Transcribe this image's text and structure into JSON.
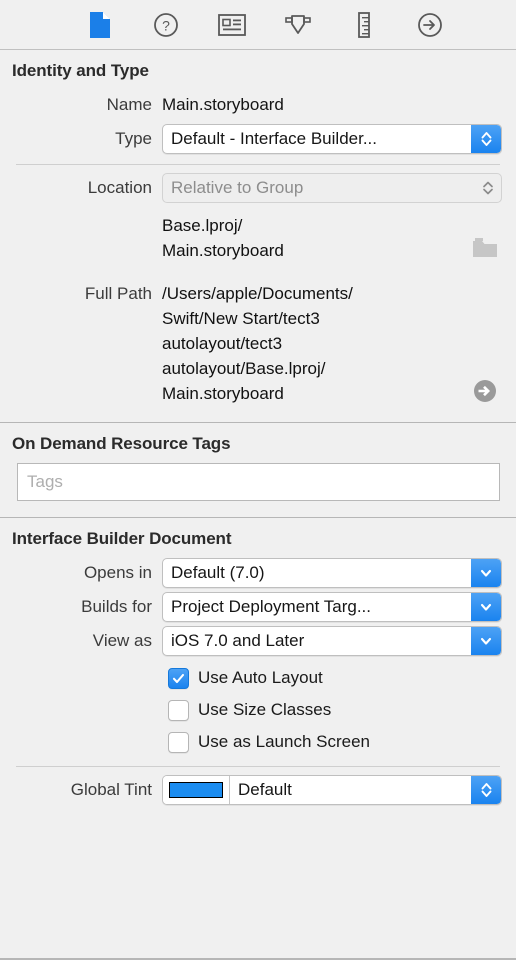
{
  "inspector": {
    "toolbar": {
      "tabs": [
        {
          "name": "file-inspector",
          "icon": "document-icon",
          "selected": true
        },
        {
          "name": "quick-help-inspector",
          "icon": "question-circle-icon",
          "selected": false
        },
        {
          "name": "identity-inspector",
          "icon": "id-card-icon",
          "selected": false
        },
        {
          "name": "attributes-inspector",
          "icon": "down-arrow-tag-icon",
          "selected": false
        },
        {
          "name": "size-inspector",
          "icon": "ruler-icon",
          "selected": false
        },
        {
          "name": "connections-inspector",
          "icon": "arrow-right-circle-icon",
          "selected": false
        }
      ],
      "selected_color": "#1b7fe8",
      "icon_color": "#595959"
    },
    "identity_and_type": {
      "title": "Identity and Type",
      "name_label": "Name",
      "name_value": "Main.storyboard",
      "type_label": "Type",
      "type_value": "Default - Interface Builder...",
      "location_label": "Location",
      "location_value": "Relative to Group",
      "location_path": "Base.lproj/\nMain.storyboard",
      "folder_icon": "folder-icon",
      "full_path_label": "Full Path",
      "full_path_value": "/Users/apple/Documents/\nSwift/New Start/tect3\nautolayout/tect3\nautolayout/Base.lproj/\nMain.storyboard",
      "reveal_icon": "arrow-right-circle-filled-icon"
    },
    "on_demand_resource_tags": {
      "title": "On Demand Resource Tags",
      "tags_placeholder": "Tags",
      "tags_value": ""
    },
    "interface_builder_document": {
      "title": "Interface Builder Document",
      "opens_in_label": "Opens in",
      "opens_in_value": "Default (7.0)",
      "builds_for_label": "Builds for",
      "builds_for_value": "Project Deployment Targ...",
      "view_as_label": "View as",
      "view_as_value": "iOS 7.0 and Later",
      "checkboxes": [
        {
          "label": "Use Auto Layout",
          "checked": true
        },
        {
          "label": "Use Size Classes",
          "checked": false
        },
        {
          "label": "Use as Launch Screen",
          "checked": false
        }
      ],
      "global_tint_label": "Global Tint",
      "global_tint_value": "Default",
      "global_tint_color": "#1b8cf0"
    }
  }
}
